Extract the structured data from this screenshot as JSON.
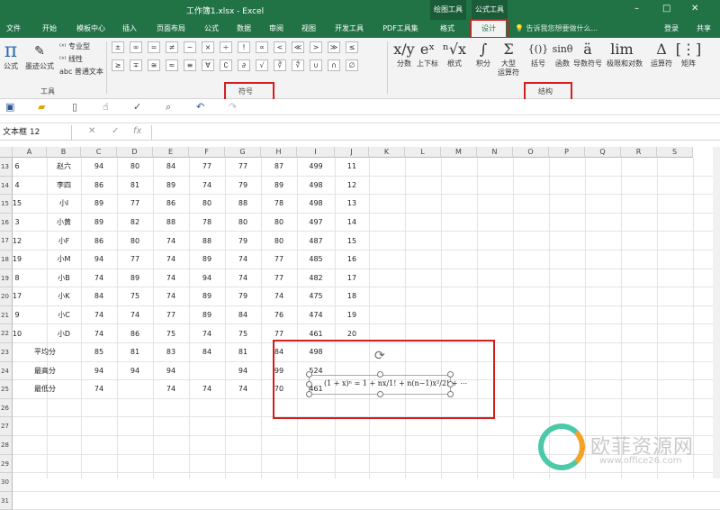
{
  "window": {
    "title": "工作簿1.xlsx - Excel",
    "ctx_drawing": "绘图工具",
    "ctx_formula": "公式工具",
    "min": "–",
    "max": "□",
    "close": "✕"
  },
  "tabs": {
    "file": "文件",
    "home": "开始",
    "template": "模板中心",
    "insert": "插入",
    "layout": "页面布局",
    "formulas": "公式",
    "data": "数据",
    "review": "审阅",
    "view": "视图",
    "developer": "开发工具",
    "pdf": "PDF工具集",
    "format": "格式",
    "design": "设计",
    "search": "告诉我您想要做什么...",
    "login": "登录",
    "share": "共享"
  },
  "ribbon": {
    "tools": {
      "equation": "公式",
      "ink": "墨迹公式",
      "professional": "专业型",
      "linear": "线性",
      "normal_text": "普通文本",
      "group": "工具"
    },
    "symbols": {
      "row1": [
        "±",
        "∞",
        "=",
        "≠",
        "~",
        "×",
        "÷",
        "!",
        "∝",
        "<",
        "≪",
        ">",
        "≫",
        "≤"
      ],
      "row2": [
        "≥",
        "∓",
        "≅",
        "≈",
        "≡",
        "∀",
        "∁",
        "∂",
        "√",
        "∛",
        "∜",
        "∪",
        "∩",
        "∅"
      ],
      "group": "符号"
    },
    "structures": {
      "items": [
        {
          "icon": "x/y",
          "label": "分数"
        },
        {
          "icon": "eˣ",
          "label": "上下标"
        },
        {
          "icon": "ⁿ√x",
          "label": "根式"
        },
        {
          "icon": "∫",
          "label": "积分"
        },
        {
          "icon": "Σ",
          "label": "大型\n运算符"
        },
        {
          "icon": "{()}",
          "label": "括号"
        },
        {
          "icon": "sinθ",
          "label": "函数"
        },
        {
          "icon": "ä",
          "label": "导数符号"
        },
        {
          "icon": "lim",
          "label": "极限和对数"
        },
        {
          "icon": "Δ",
          "label": "运算符"
        },
        {
          "icon": "[⋮]",
          "label": "矩阵"
        }
      ],
      "group": "结构"
    }
  },
  "formula_bar": {
    "name_box": "文本框 12",
    "cancel": "✕",
    "enter": "✓",
    "fx": "fx"
  },
  "columns": [
    "A",
    "B",
    "C",
    "D",
    "E",
    "F",
    "G",
    "H",
    "I",
    "J",
    "K",
    "L",
    "M",
    "N",
    "O",
    "P",
    "Q",
    "R",
    "S"
  ],
  "rows": [
    {
      "num": "13",
      "cells": [
        "6",
        "赵六",
        "94",
        "80",
        "84",
        "77",
        "77",
        "87",
        "499",
        "11"
      ]
    },
    {
      "num": "14",
      "cells": [
        "4",
        "李四",
        "86",
        "81",
        "89",
        "74",
        "79",
        "89",
        "498",
        "12"
      ]
    },
    {
      "num": "15",
      "cells": [
        "15",
        "小I",
        "89",
        "77",
        "86",
        "80",
        "88",
        "78",
        "498",
        "13"
      ]
    },
    {
      "num": "16",
      "cells": [
        "3",
        "小黄",
        "89",
        "82",
        "88",
        "78",
        "80",
        "80",
        "497",
        "14"
      ]
    },
    {
      "num": "17",
      "cells": [
        "12",
        "小F",
        "86",
        "80",
        "74",
        "88",
        "79",
        "80",
        "487",
        "15"
      ]
    },
    {
      "num": "18",
      "cells": [
        "19",
        "小M",
        "94",
        "77",
        "74",
        "89",
        "74",
        "77",
        "485",
        "16"
      ]
    },
    {
      "num": "19",
      "cells": [
        "8",
        "小B",
        "74",
        "89",
        "74",
        "94",
        "74",
        "77",
        "482",
        "17"
      ]
    },
    {
      "num": "20",
      "cells": [
        "17",
        "小K",
        "84",
        "75",
        "74",
        "89",
        "79",
        "74",
        "475",
        "18"
      ]
    },
    {
      "num": "21",
      "cells": [
        "9",
        "小C",
        "74",
        "74",
        "77",
        "89",
        "84",
        "76",
        "474",
        "19"
      ]
    },
    {
      "num": "22",
      "cells": [
        "10",
        "小D",
        "74",
        "86",
        "75",
        "74",
        "75",
        "77",
        "461",
        "20"
      ]
    },
    {
      "num": "23",
      "cells": [
        "平均分",
        "",
        "85",
        "81",
        "83",
        "84",
        "81",
        "84",
        "498",
        ""
      ]
    },
    {
      "num": "24",
      "cells": [
        "最高分",
        "",
        "94",
        "94",
        "94",
        "",
        "94",
        "99",
        "524",
        ""
      ]
    },
    {
      "num": "25",
      "cells": [
        "最低分",
        "",
        "74",
        "",
        "74",
        "74",
        "74",
        "70",
        "461",
        ""
      ]
    },
    {
      "num": "26",
      "cells": [
        "",
        "",
        "",
        "",
        "",
        "",
        "",
        "",
        "",
        ""
      ]
    },
    {
      "num": "27",
      "cells": [
        "",
        "",
        "",
        "",
        "",
        "",
        "",
        "",
        "",
        ""
      ]
    },
    {
      "num": "28",
      "cells": [
        "",
        "",
        "",
        "",
        "",
        "",
        "",
        "",
        "",
        ""
      ]
    },
    {
      "num": "29",
      "cells": [
        "",
        "",
        "",
        "",
        "",
        "",
        "",
        "",
        "",
        ""
      ]
    },
    {
      "num": "30",
      "cells": [
        "",
        "",
        "",
        "",
        "",
        "",
        "",
        "",
        "",
        ""
      ]
    },
    {
      "num": "31",
      "cells": [
        "",
        "",
        "",
        "",
        "",
        "",
        "",
        "",
        "",
        ""
      ]
    }
  ],
  "equation": {
    "text": "(1 + x)ⁿ = 1 + nx/1! + n(n−1)x²/2! + ⋯"
  },
  "watermark": {
    "name": "欧菲资源网",
    "url": "www.office26.com"
  }
}
